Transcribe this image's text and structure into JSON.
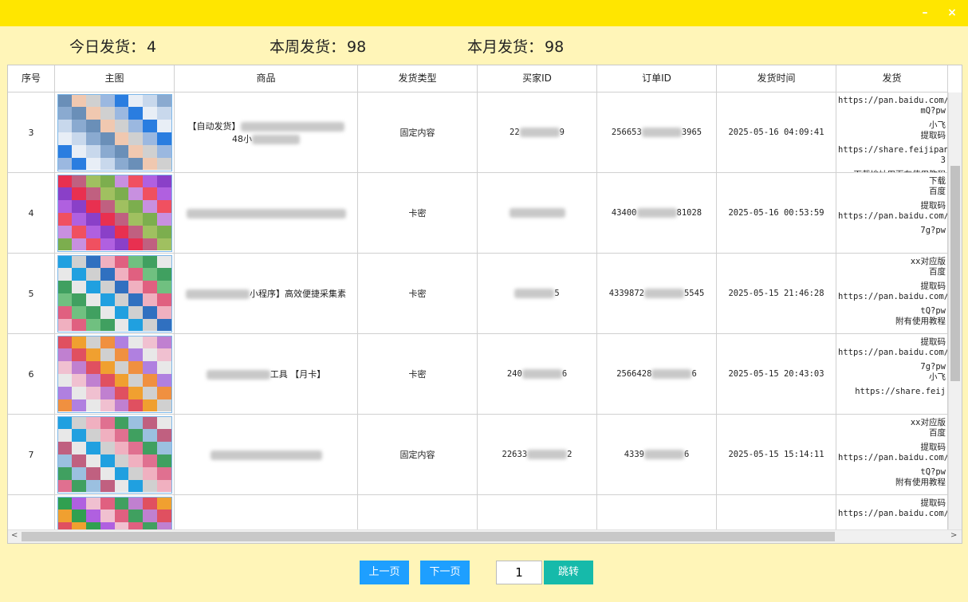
{
  "window": {
    "minimize_label": "–",
    "close_label": "×"
  },
  "stats": {
    "today_label": "今日发货：",
    "today_value": "4",
    "week_label": "本周发货：",
    "week_value": "98",
    "month_label": "本月发货：",
    "month_value": "98"
  },
  "table": {
    "columns": [
      "序号",
      "主图",
      "商品",
      "发货类型",
      "买家ID",
      "订单ID",
      "发货时间",
      "发货"
    ],
    "rows": [
      {
        "seq": "3",
        "product": "【自动发货】",
        "product_suffix": "48小",
        "type": "固定内容",
        "buyer_prefix": "22",
        "buyer_suffix": "9",
        "order_prefix": "256653",
        "order_suffix": "3965",
        "time": "2025-05-16 04:09:41",
        "delivery": [
          "https://pan.baidu.com/",
          "mQ?pw",
          "小飞",
          "提取码",
          "https://share.feijipan",
          "3",
          "下载地址用而有使用教程"
        ]
      },
      {
        "seq": "4",
        "product": "",
        "product_suffix": "",
        "type": "卡密",
        "buyer_prefix": "",
        "buyer_suffix": "",
        "order_prefix": "43400",
        "order_suffix": "81028",
        "time": "2025-05-16 00:53:59",
        "delivery": [
          "下载",
          "百度",
          "提取码",
          "https://pan.baidu.com/",
          "7g?pw"
        ]
      },
      {
        "seq": "5",
        "product": "高效便捷采集素",
        "product_suffix": "小程序】",
        "type": "卡密",
        "buyer_prefix": "",
        "buyer_suffix": "5",
        "order_prefix": "4339872",
        "order_suffix": "5545",
        "time": "2025-05-15 21:46:28",
        "delivery": [
          "xx对应版",
          "百度",
          "提取码",
          "https://pan.baidu.com/",
          "tQ?pw",
          "附有使用教程"
        ]
      },
      {
        "seq": "6",
        "product": "工具 【月卡】",
        "product_suffix": "",
        "type": "卡密",
        "buyer_prefix": "240",
        "buyer_suffix": "6",
        "order_prefix": "2566428",
        "order_suffix": "6",
        "time": "2025-05-15 20:43:03",
        "delivery": [
          "提取码",
          "https://pan.baidu.com/",
          "7g?pw",
          "小飞",
          "https://share.feij"
        ]
      },
      {
        "seq": "7",
        "product": "",
        "product_suffix": "",
        "type": "固定内容",
        "buyer_prefix": "22633",
        "buyer_suffix": "2",
        "order_prefix": "4339",
        "order_suffix": "6",
        "time": "2025-05-15 15:14:11",
        "delivery": [
          "xx对应版",
          "百度",
          "提取码",
          "https://pan.baidu.com/",
          "tQ?pw",
          "附有使用教程"
        ]
      },
      {
        "seq": "",
        "product": "",
        "product_suffix": "",
        "type": "",
        "buyer_prefix": "",
        "buyer_suffix": "",
        "order_prefix": "",
        "order_suffix": "",
        "time": "",
        "delivery": [
          "提取码",
          "https://pan.baidu.com/"
        ]
      }
    ]
  },
  "scroll": {
    "left_arrow": "<",
    "right_arrow": ">",
    "up_arrow": "▲",
    "down_arrow": "▼"
  },
  "pager": {
    "prev": "上一页",
    "next": "下一页",
    "page_value": "1",
    "jump": "跳转"
  },
  "colors": {
    "titlebar": "#ffe600",
    "background": "#fff5b8",
    "primary_button": "#1e9fff",
    "jump_button": "#16baaa"
  }
}
